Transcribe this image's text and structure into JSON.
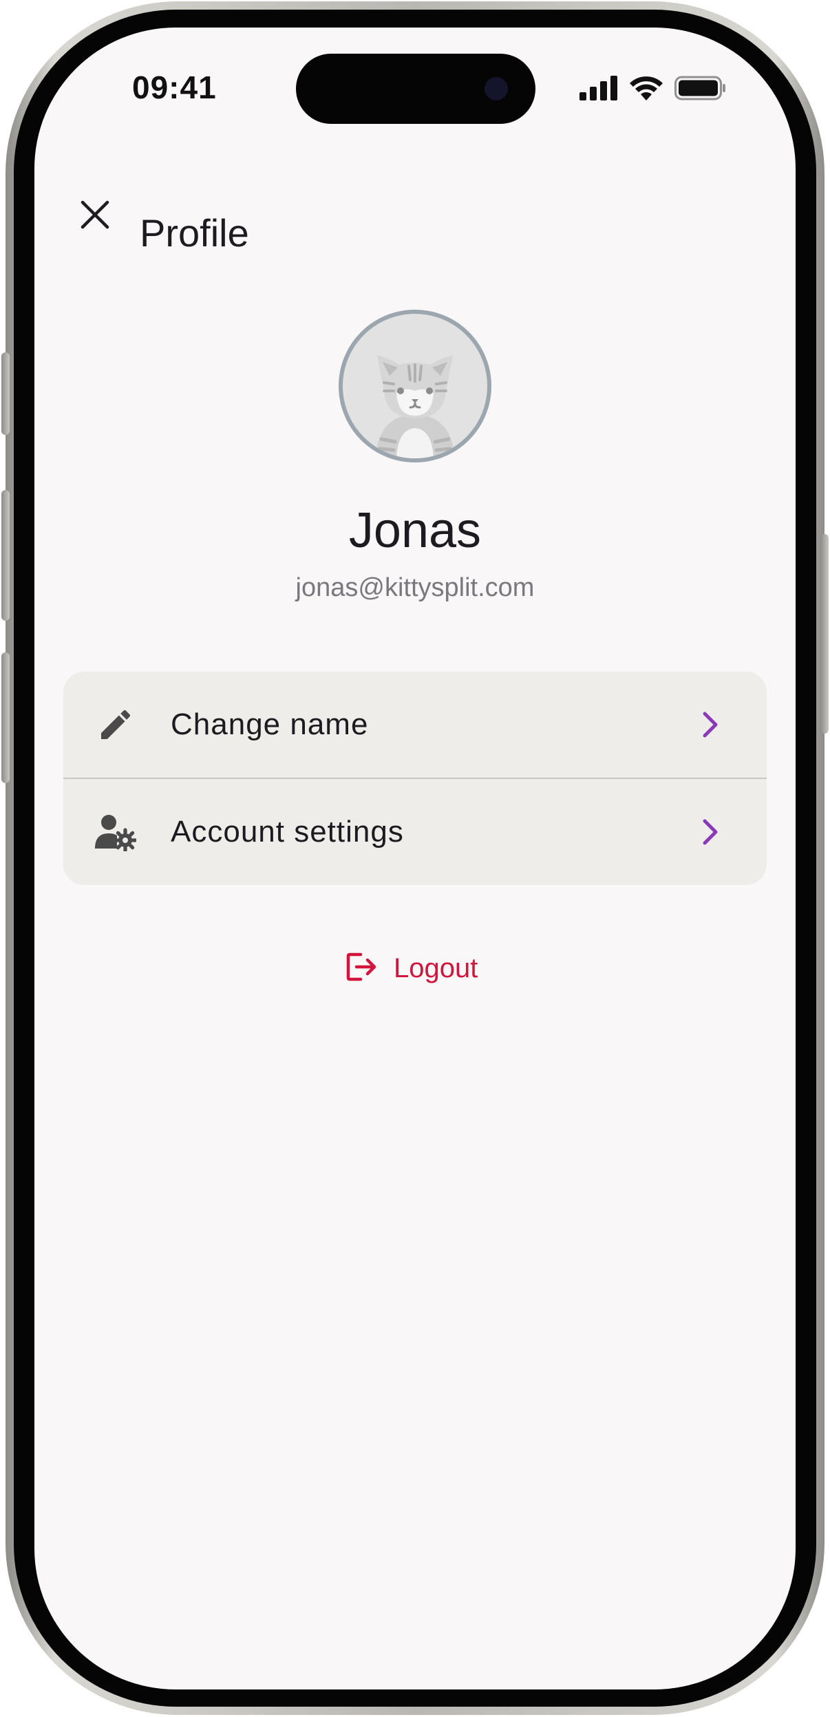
{
  "status_bar": {
    "time": "09:41",
    "signal_icon": "cellular-signal-icon",
    "wifi_icon": "wifi-icon",
    "battery_icon": "battery-icon"
  },
  "header": {
    "close_icon": "close-icon",
    "title": "Profile"
  },
  "profile": {
    "avatar_icon": "cat-avatar-icon",
    "name": "Jonas",
    "email": "jonas@kittysplit.com"
  },
  "menu": {
    "items": [
      {
        "label": "Change name",
        "icon": "pencil-icon",
        "chevron": "chevron-right-icon"
      },
      {
        "label": "Account settings",
        "icon": "user-gear-icon",
        "chevron": "chevron-right-icon"
      }
    ]
  },
  "logout": {
    "label": "Logout",
    "icon": "logout-icon"
  },
  "colors": {
    "background": "#f9f7f8",
    "card": "#efedea",
    "accent": "#8a3ab9",
    "logout": "#d2153d",
    "text": "#1c1b1f",
    "muted": "#7a787c"
  }
}
